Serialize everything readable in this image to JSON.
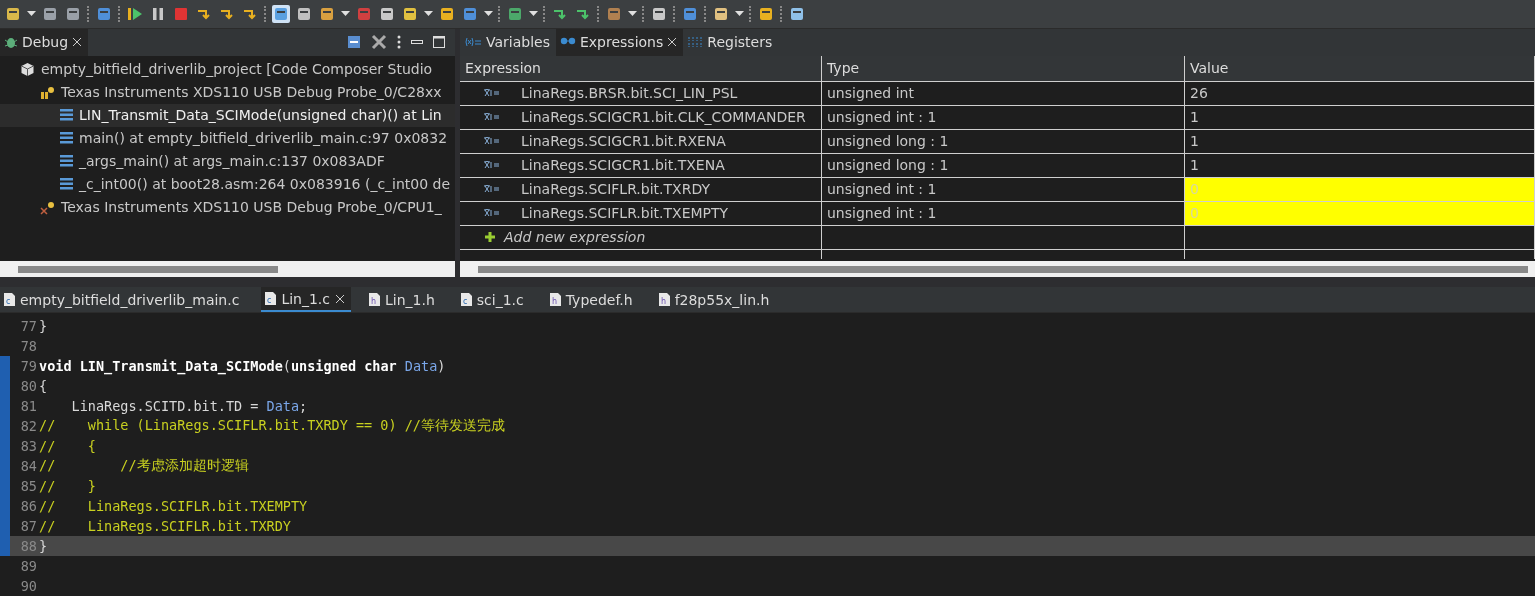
{
  "debug_view": {
    "tab": {
      "label": "Debug",
      "selected": true
    },
    "tree": [
      {
        "label": "empty_bitfield_driverlib_project [Code Composer Studio",
        "kind": "project",
        "selected": false,
        "children": [
          {
            "label": "Texas Instruments XDS110 USB Debug Probe_0/C28xx",
            "kind": "target",
            "selected": false,
            "children": [
              {
                "label": "LIN_Transmit_Data_SCIMode(unsigned char)() at Lin",
                "kind": "frame",
                "selected": true
              },
              {
                "label": "main() at empty_bitfield_driverlib_main.c:97 0x0832",
                "kind": "frame",
                "selected": false
              },
              {
                "label": "_args_main() at args_main.c:137 0x083ADF",
                "kind": "frame",
                "selected": false
              },
              {
                "label": "_c_int00() at boot28.asm:264 0x083916  (_c_int00 de",
                "kind": "frame",
                "selected": false
              }
            ]
          },
          {
            "label": "Texas Instruments XDS110 USB Debug Probe_0/CPU1_",
            "kind": "target_off",
            "selected": false
          }
        ]
      }
    ]
  },
  "expressions_view": {
    "tabs": [
      {
        "label": "Variables",
        "selected": false
      },
      {
        "label": "Expressions",
        "selected": true
      },
      {
        "label": "Registers",
        "selected": false
      }
    ],
    "columns": [
      "Expression",
      "Type",
      "Value"
    ],
    "rows": [
      {
        "expression": "LinaRegs.BRSR.bit.SCI_LIN_PSL",
        "type": "unsigned int",
        "value": "26",
        "changed": false
      },
      {
        "expression": "LinaRegs.SCIGCR1.bit.CLK_COMMANDER",
        "type": "unsigned int : 1",
        "value": "1",
        "changed": false
      },
      {
        "expression": "LinaRegs.SCIGCR1.bit.RXENA",
        "type": "unsigned long : 1",
        "value": "1",
        "changed": false
      },
      {
        "expression": "LinaRegs.SCIGCR1.bit.TXENA",
        "type": "unsigned long : 1",
        "value": "1",
        "changed": false
      },
      {
        "expression": "LinaRegs.SCIFLR.bit.TXRDY",
        "type": "unsigned int : 1",
        "value": "0",
        "changed": true
      },
      {
        "expression": "LinaRegs.SCIFLR.bit.TXEMPTY",
        "type": "unsigned int : 1",
        "value": "0",
        "changed": true
      }
    ],
    "add_row": "Add new expression"
  },
  "editor": {
    "tabs": [
      {
        "label": "empty_bitfield_driverlib_main.c",
        "file": "c",
        "selected": false
      },
      {
        "label": "Lin_1.c",
        "file": "c",
        "selected": true
      },
      {
        "label": "Lin_1.h",
        "file": "h",
        "selected": false
      },
      {
        "label": "sci_1.c",
        "file": "c",
        "selected": false
      },
      {
        "label": "Typedef.h",
        "file": "h",
        "selected": false
      },
      {
        "label": "f28p55x_lin.h",
        "file": "h",
        "selected": false
      }
    ],
    "lines": [
      {
        "number": "77",
        "current": false,
        "in_range": false,
        "segments": [
          {
            "kind": "plain",
            "text": "}"
          }
        ]
      },
      {
        "number": "78",
        "current": false,
        "in_range": false
      },
      {
        "number": "79",
        "current": false,
        "in_range": true,
        "segments": [
          {
            "kind": "keyword",
            "text": "void LIN_Transmit_Data_SCIMode"
          },
          {
            "kind": "plain",
            "text": "("
          },
          {
            "kind": "keyword",
            "text": "unsigned char"
          },
          {
            "kind": "param",
            "text": " Data"
          },
          {
            "kind": "plain",
            "text": ")"
          }
        ]
      },
      {
        "number": "80",
        "current": false,
        "in_range": true,
        "segments": [
          {
            "kind": "plain",
            "text": "{"
          }
        ]
      },
      {
        "number": "81",
        "current": false,
        "in_range": true,
        "segments": [
          {
            "kind": "plain",
            "text": "    LinaRegs.SCITD.bit.TD = "
          },
          {
            "kind": "param",
            "text": "Data"
          },
          {
            "kind": "plain",
            "text": ";"
          }
        ]
      },
      {
        "number": "82",
        "current": false,
        "in_range": true,
        "segments": [
          {
            "kind": "comment",
            "text": "//    while (LinaRegs.SCIFLR.bit.TXRDY == 0) //等待发送完成"
          }
        ]
      },
      {
        "number": "83",
        "current": false,
        "in_range": true,
        "segments": [
          {
            "kind": "comment",
            "text": "//    {"
          }
        ]
      },
      {
        "number": "84",
        "current": false,
        "in_range": true,
        "segments": [
          {
            "kind": "comment",
            "text": "//        //考虑添加超时逻辑"
          }
        ]
      },
      {
        "number": "85",
        "current": false,
        "in_range": true,
        "segments": [
          {
            "kind": "comment",
            "text": "//    }"
          }
        ]
      },
      {
        "number": "86",
        "current": false,
        "in_range": true,
        "segments": [
          {
            "kind": "comment",
            "text": "//    LinaRegs.SCIFLR.bit.TXEMPTY"
          }
        ]
      },
      {
        "number": "87",
        "current": false,
        "in_range": true,
        "segments": [
          {
            "kind": "comment",
            "text": "//    LinaRegs.SCIFLR.bit.TXRDY"
          }
        ]
      },
      {
        "number": "88",
        "current": true,
        "in_range": true,
        "segments": [
          {
            "kind": "plain",
            "text": "}"
          }
        ]
      },
      {
        "number": "89",
        "current": false,
        "in_range": false
      },
      {
        "number": "90",
        "current": false,
        "in_range": false
      }
    ]
  }
}
